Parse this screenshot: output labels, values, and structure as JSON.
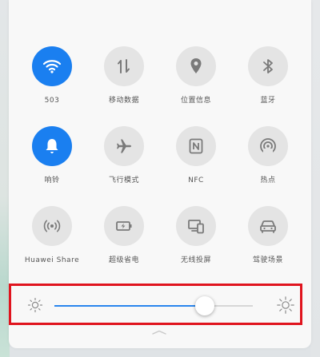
{
  "colors": {
    "accent": "#1a7ff0",
    "inactive_tile": "#e4e4e4",
    "icon_inactive": "#7a7a7a",
    "highlight_border": "#e0141e"
  },
  "tiles": [
    {
      "label": "503",
      "icon": "wifi-icon",
      "active": true
    },
    {
      "label": "移动数据",
      "icon": "mobile-data-icon",
      "active": false
    },
    {
      "label": "位置信息",
      "icon": "location-pin-icon",
      "active": false
    },
    {
      "label": "蓝牙",
      "icon": "bluetooth-icon",
      "active": false
    },
    {
      "label": "响铃",
      "icon": "bell-icon",
      "active": true
    },
    {
      "label": "飞行模式",
      "icon": "airplane-icon",
      "active": false
    },
    {
      "label": "NFC",
      "icon": "nfc-icon",
      "active": false
    },
    {
      "label": "热点",
      "icon": "hotspot-icon",
      "active": false
    },
    {
      "label": "Huawei Share",
      "icon": "huawei-share-icon",
      "active": false
    },
    {
      "label": "超级省电",
      "icon": "battery-saver-icon",
      "active": false
    },
    {
      "label": "无线投屏",
      "icon": "wireless-projection-icon",
      "active": false
    },
    {
      "label": "驾驶场景",
      "icon": "driving-mode-icon",
      "active": false
    }
  ],
  "brightness": {
    "level": 0.76,
    "low_icon": "brightness-low-icon",
    "high_icon": "brightness-high-icon"
  },
  "handle_icon": "chevron-up-icon"
}
